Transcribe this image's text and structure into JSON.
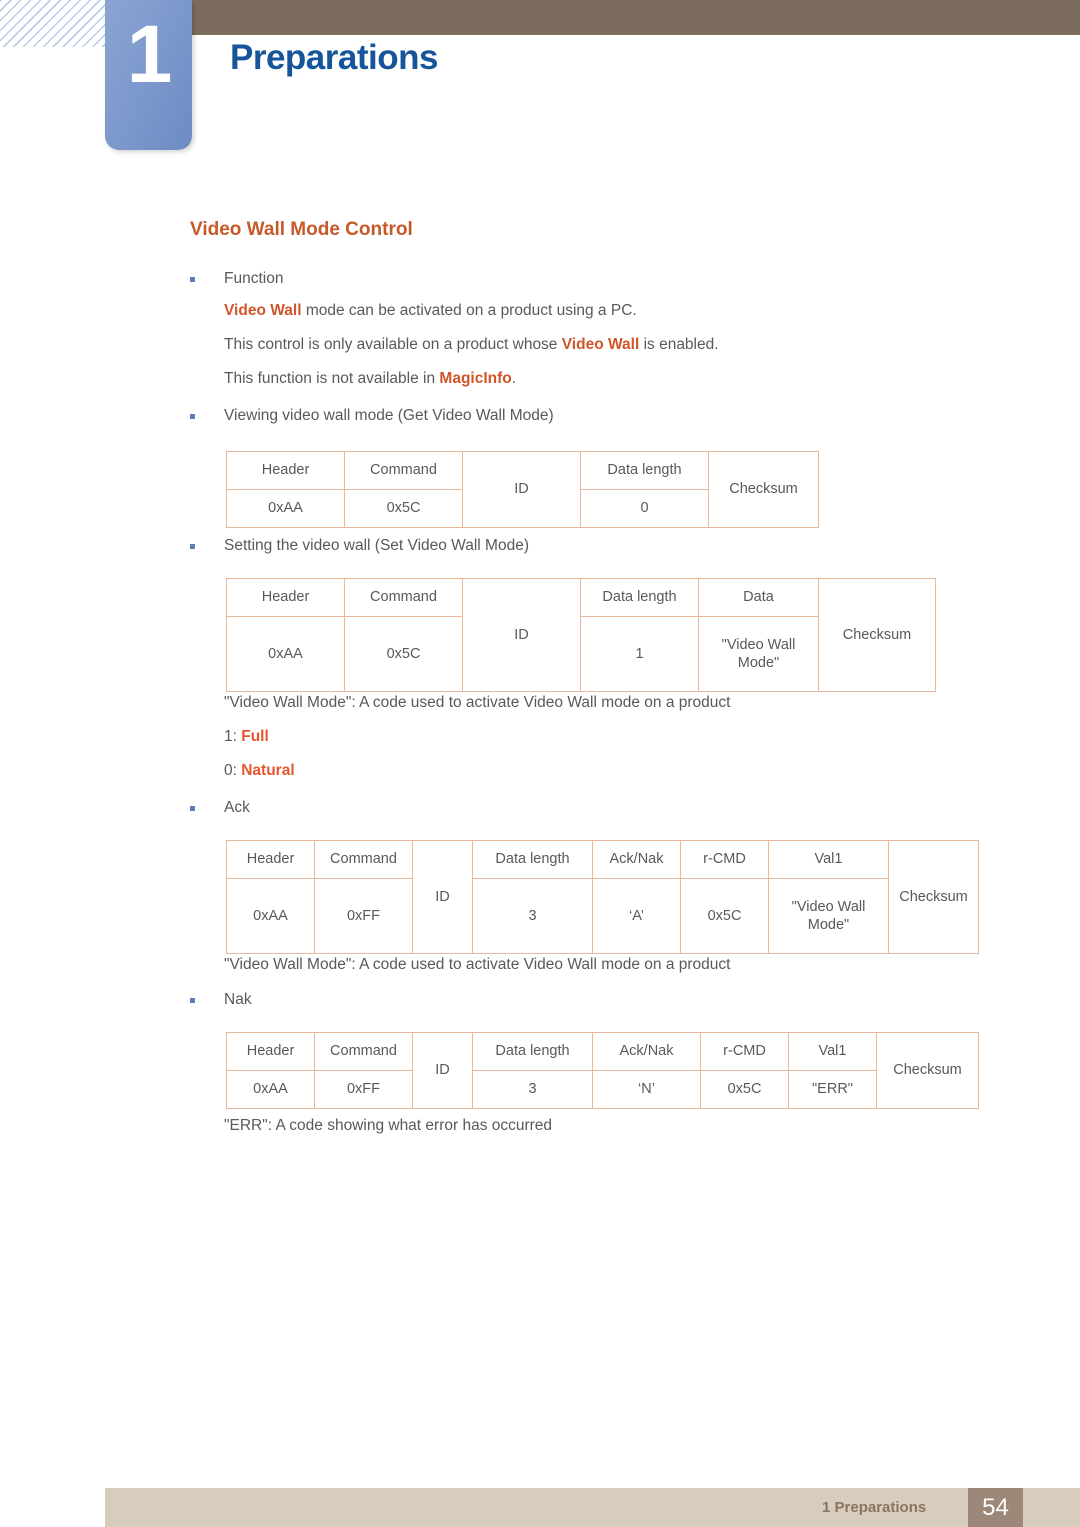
{
  "header": {
    "chapter_number": "1",
    "chapter_title": "Preparations"
  },
  "section": {
    "title": "Video Wall Mode Control"
  },
  "blocks": {
    "function_bullet": "Function",
    "function_line1_pre": "",
    "function_line1_hl": "Video Wall",
    "function_line1_post": " mode can be activated on a product using a PC.",
    "function_line2_pre": "This control is only available on a product whose ",
    "function_line2_hl": "Video Wall",
    "function_line2_post": " is enabled.",
    "function_line3_pre": "This function is not available in ",
    "function_line3_hl": "MagicInfo",
    "function_line3_post": ".",
    "get_bullet": "Viewing video wall mode (Get Video Wall Mode)",
    "set_bullet": "Setting the video wall (Set Video Wall Mode)",
    "videowallmode_note": "\"Video Wall Mode\": A code used to activate Video Wall mode on a product",
    "code_full_pre": "1: ",
    "code_full_hl": "Full",
    "code_natural_pre": "0: ",
    "code_natural_hl": "Natural",
    "ack_bullet": "Ack",
    "ack_note": "\"Video Wall Mode\": A code used to activate Video Wall mode on a product",
    "nak_bullet": "Nak",
    "err_note": "\"ERR\": A code showing what error has occurred"
  },
  "tables": {
    "get": {
      "headers": [
        "Header",
        "Command",
        "ID",
        "Data length",
        "Checksum"
      ],
      "values": [
        "0xAA",
        "0x5C",
        "ID",
        "0",
        "Checksum"
      ]
    },
    "set": {
      "headers": [
        "Header",
        "Command",
        "ID",
        "Data length",
        "Data",
        "Checksum"
      ],
      "values": [
        "0xAA",
        "0x5C",
        "ID",
        "1",
        "\"Video Wall Mode\"",
        "Checksum"
      ]
    },
    "ack": {
      "headers": [
        "Header",
        "Command",
        "ID",
        "Data length",
        "Ack/Nak",
        "r-CMD",
        "Val1",
        "Checksum"
      ],
      "values": [
        "0xAA",
        "0xFF",
        "ID",
        "3",
        "‘A’",
        "0x5C",
        "\"Video Wall Mode\"",
        "Checksum"
      ]
    },
    "nak": {
      "headers": [
        "Header",
        "Command",
        "ID",
        "Data length",
        "Ack/Nak",
        "r-CMD",
        "Val1",
        "Checksum"
      ],
      "values": [
        "0xAA",
        "0xFF",
        "ID",
        "3",
        "‘N’",
        "0x5C",
        "\"ERR\"",
        "Checksum"
      ]
    }
  },
  "footer": {
    "label": "1 Preparations",
    "page": "54"
  },
  "colors": {
    "accent_orange": "#c65a28",
    "chapter_blue": "#17559b",
    "header_brown": "#7c6c5d",
    "footer_beige": "#d8cdbd",
    "page_box": "#9c8878"
  }
}
